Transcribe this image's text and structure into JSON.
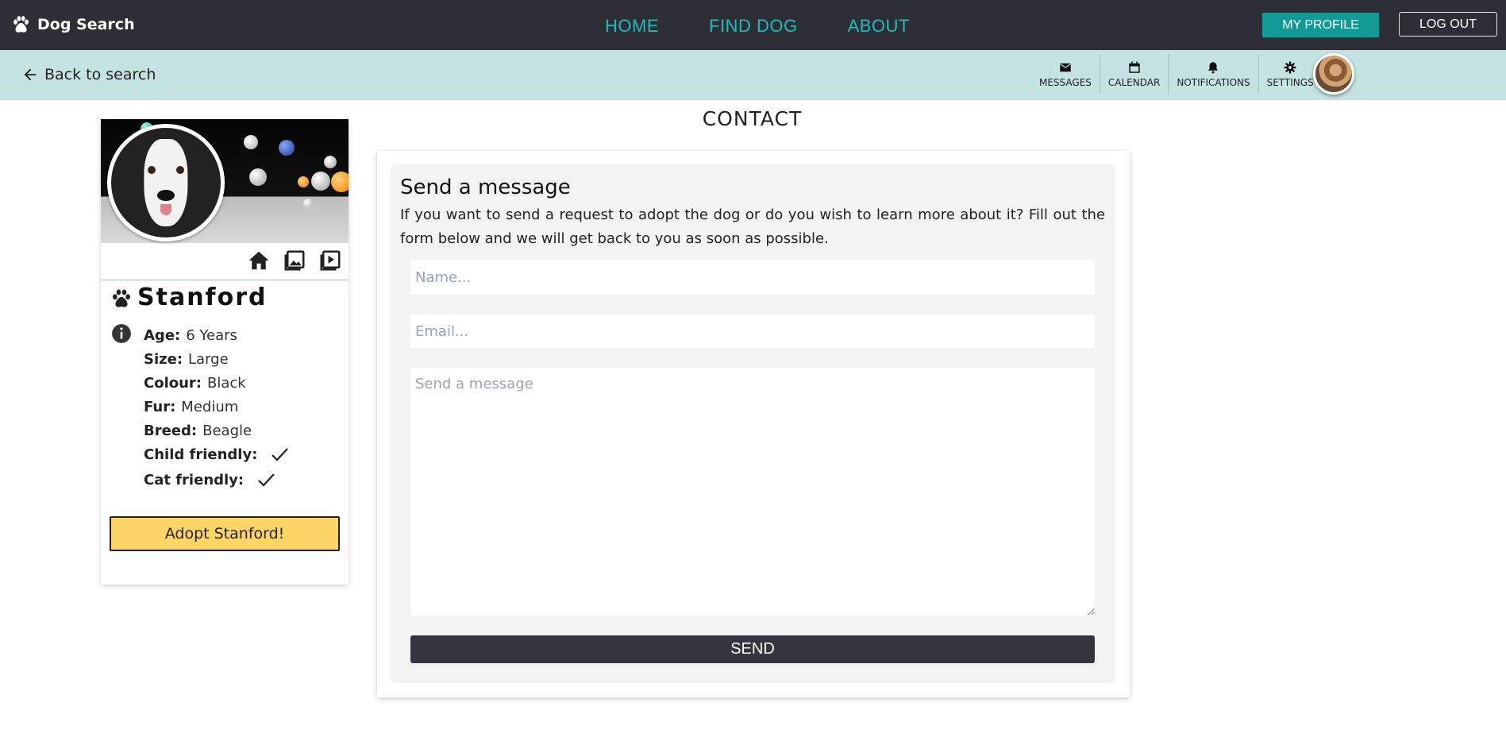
{
  "topbar": {
    "brand": "Dog Search",
    "nav": [
      "HOME",
      "FIND DOG",
      "ABOUT"
    ],
    "profile_button": "MY PROFILE",
    "logout_button": "LOG OUT",
    "accent_color": "#1fbcbc"
  },
  "subbar": {
    "back_label": "Back to search",
    "tools": [
      "MESSAGES",
      "CALENDAR",
      "NOTIFICATIONS",
      "SETTINGS"
    ]
  },
  "dog": {
    "name": "Stanford",
    "attributes": [
      {
        "key": "Age:",
        "value": "6 Years"
      },
      {
        "key": "Size:",
        "value": "Large"
      },
      {
        "key": "Colour:",
        "value": "Black"
      },
      {
        "key": "Fur:",
        "value": "Medium"
      },
      {
        "key": "Breed:",
        "value": "Beagle"
      },
      {
        "key": "Child friendly:",
        "value": true
      },
      {
        "key": "Cat friendly:",
        "value": true
      }
    ],
    "adopt_button": "Adopt Stanford!"
  },
  "contact": {
    "title": "CONTACT",
    "heading": "Send a message",
    "intro": "If you want to send a request to adopt the dog or do you wish to learn more about it? Fill out the form below and we will get back to you as soon as possible.",
    "name_placeholder": "Name...",
    "email_placeholder": "Email...",
    "message_placeholder": "Send a message",
    "send_button": "SEND"
  }
}
